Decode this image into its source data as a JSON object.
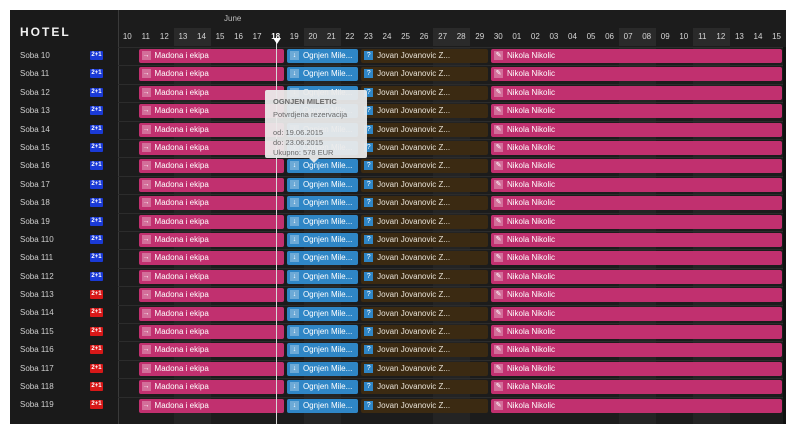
{
  "hotel_title": "HOTEL",
  "month_label": "June",
  "days": [
    "10",
    "11",
    "12",
    "13",
    "14",
    "15",
    "16",
    "17",
    "18",
    "19",
    "20",
    "21",
    "22",
    "23",
    "24",
    "25",
    "26",
    "27",
    "28",
    "29",
    "30",
    "01",
    "02",
    "03",
    "04",
    "05",
    "06",
    "07",
    "08",
    "09",
    "10",
    "11",
    "12",
    "13",
    "14",
    "15"
  ],
  "weekend_flags": [
    false,
    false,
    false,
    true,
    true,
    false,
    false,
    false,
    false,
    false,
    true,
    true,
    false,
    false,
    false,
    false,
    false,
    true,
    true,
    false,
    false,
    false,
    false,
    false,
    false,
    false,
    false,
    true,
    true,
    false,
    false,
    true,
    true,
    false,
    false,
    false
  ],
  "today": "18",
  "rooms": [
    {
      "name": "Soba 10",
      "badge": "2+1",
      "badge_color": "#1a3ad6"
    },
    {
      "name": "Soba 11",
      "badge": "2+1",
      "badge_color": "#1a3ad6"
    },
    {
      "name": "Soba 12",
      "badge": "2+1",
      "badge_color": "#1a3ad6"
    },
    {
      "name": "Soba 13",
      "badge": "2+1",
      "badge_color": "#1a3ad6"
    },
    {
      "name": "Soba 14",
      "badge": "2+1",
      "badge_color": "#1a3ad6"
    },
    {
      "name": "Soba 15",
      "badge": "2+1",
      "badge_color": "#1a3ad6"
    },
    {
      "name": "Soba 16",
      "badge": "2+1",
      "badge_color": "#1a3ad6"
    },
    {
      "name": "Soba 17",
      "badge": "2+1",
      "badge_color": "#1a3ad6"
    },
    {
      "name": "Soba 18",
      "badge": "2+1",
      "badge_color": "#1a3ad6"
    },
    {
      "name": "Soba 19",
      "badge": "2+1",
      "badge_color": "#1a3ad6"
    },
    {
      "name": "Soba 110",
      "badge": "2+1",
      "badge_color": "#1a3ad6"
    },
    {
      "name": "Soba 111",
      "badge": "2+1",
      "badge_color": "#1a3ad6"
    },
    {
      "name": "Soba 112",
      "badge": "2+1",
      "badge_color": "#1a3ad6"
    },
    {
      "name": "Soba 113",
      "badge": "2+1",
      "badge_color": "#d81818"
    },
    {
      "name": "Soba 114",
      "badge": "2+1",
      "badge_color": "#d81818"
    },
    {
      "name": "Soba 115",
      "badge": "2+1",
      "badge_color": "#d81818"
    },
    {
      "name": "Soba 116",
      "badge": "2+1",
      "badge_color": "#d81818"
    },
    {
      "name": "Soba 117",
      "badge": "2+1",
      "badge_color": "#d81818"
    },
    {
      "name": "Soba 118",
      "badge": "2+1",
      "badge_color": "#d81818"
    },
    {
      "name": "Soba 119",
      "badge": "2+1",
      "badge_color": "#d81818"
    }
  ],
  "reservations": [
    {
      "label": "Madona i ekipa",
      "color": "pink",
      "icon": "arrow-right-icon",
      "start": "11",
      "end": "19"
    },
    {
      "label": "Ognjen Mile...",
      "color": "blue",
      "icon": "arrow-down-icon",
      "start": "19",
      "end": "23"
    },
    {
      "label": "Jovan Jovanovic Z...",
      "color": "brown",
      "icon": "question-icon",
      "start": "23",
      "end": "30"
    },
    {
      "label": "Nikola Nikolic",
      "color": "pink",
      "icon": "edit-icon",
      "start": "30",
      "end": "15"
    }
  ],
  "colors": {
    "pink": "#c1306f",
    "blue": "#2f86c6",
    "brown": "#3b2a12",
    "background": "#1c1c1c"
  },
  "tooltip": {
    "name": "OGNJEN MILETIC",
    "status": "Potvrdjena rezervacija",
    "from": "od: 19.06.2015",
    "to": "do: 23.06.2015",
    "total": "Ukupno: 578 EUR"
  }
}
